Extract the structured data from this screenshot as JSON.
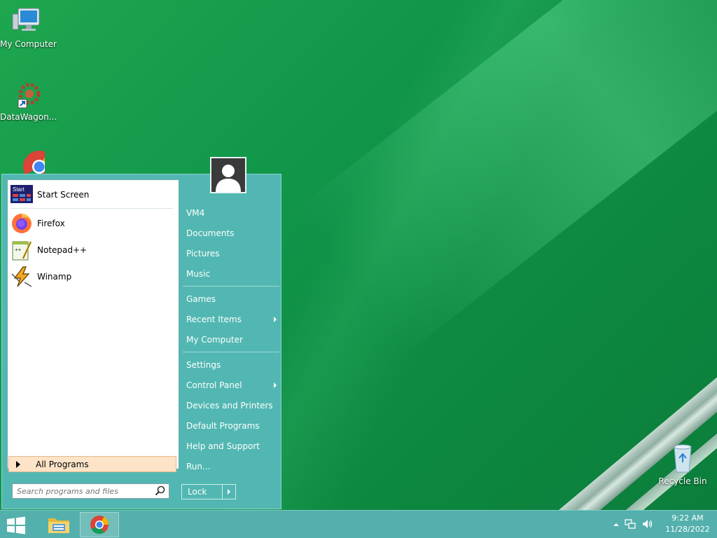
{
  "desktop": {
    "icons": [
      {
        "label": "My Computer",
        "icon": "computer-icon"
      },
      {
        "label": "DataWagon...",
        "icon": "datawagon-icon"
      },
      {
        "label": "",
        "icon": "chrome-icon"
      },
      {
        "label": "Recycle Bin",
        "icon": "recycle-bin-icon"
      }
    ]
  },
  "start_menu": {
    "pinned": [
      {
        "label": "Start Screen",
        "icon": "start-screen-icon",
        "icon_text": "Start"
      }
    ],
    "recent": [
      {
        "label": "Firefox",
        "icon": "firefox-icon"
      },
      {
        "label": "Notepad++",
        "icon": "notepadpp-icon",
        "icon_text": "++"
      },
      {
        "label": "Winamp",
        "icon": "winamp-icon"
      }
    ],
    "all_programs": "All Programs",
    "search": {
      "placeholder": "Search programs and files",
      "value": ""
    },
    "right_items": {
      "vm4": "VM4",
      "documents": "Documents",
      "pictures": "Pictures",
      "music": "Music",
      "games": "Games",
      "recent_items": "Recent Items",
      "my_computer": "My Computer",
      "settings": "Settings",
      "control_panel": "Control Panel",
      "devices_printers": "Devices and Printers",
      "default_programs": "Default Programs",
      "help_support": "Help and Support",
      "run": "Run..."
    },
    "lock_button": "Lock"
  },
  "taskbar": {
    "items": [
      {
        "icon": "file-explorer-icon",
        "active": false
      },
      {
        "icon": "chrome-icon",
        "active": true
      }
    ],
    "tray": [
      "show-hidden-icons",
      "network-icon",
      "volume-icon"
    ],
    "clock": {
      "time": "9:22 AM",
      "date": "11/28/2022"
    }
  },
  "colors": {
    "desktop_green": "#11974a",
    "menu_teal": "#52b7b2",
    "all_programs_highlight": "#fde4c8"
  }
}
